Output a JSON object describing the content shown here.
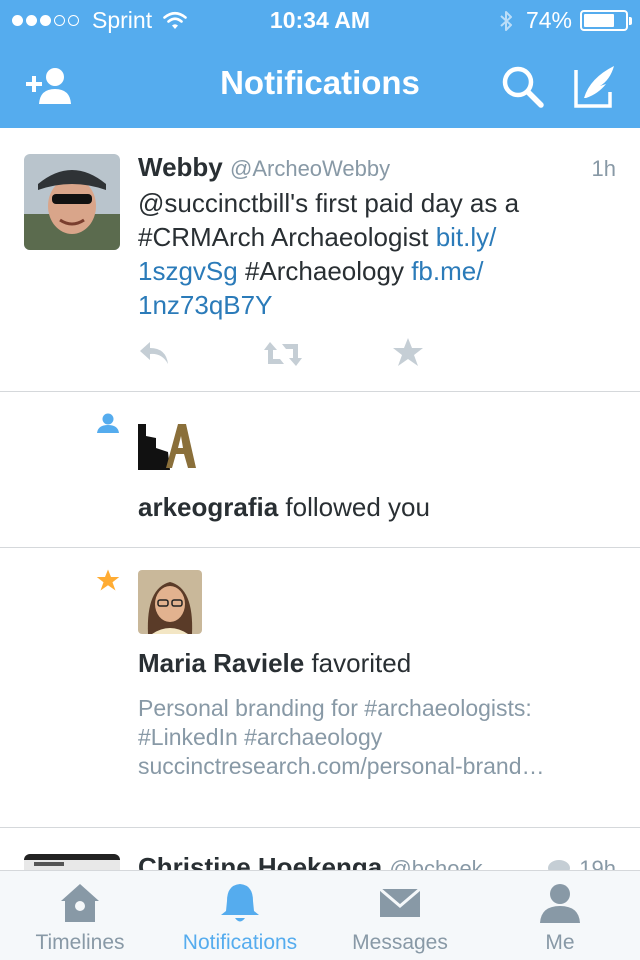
{
  "status_bar": {
    "carrier": "Sprint",
    "time": "10:34 AM",
    "battery": "74%",
    "battery_level": 0.74,
    "signal_bars_filled": 3,
    "signal_bars_total": 5
  },
  "nav": {
    "title": "Notifications",
    "left_icon": "add-user-icon",
    "right_icons": [
      "search-icon",
      "compose-icon"
    ]
  },
  "notifications": [
    {
      "type": "tweet",
      "name": "Webby",
      "handle": "@ArcheoWebby",
      "time": "1h",
      "lines": [
        [
          {
            "t": "@succinctbill's first paid day as a",
            "link": false
          }
        ],
        [
          {
            "t": "#CRMArch Archaeologist ",
            "link": false
          },
          {
            "t": "bit.ly/",
            "link": true
          }
        ],
        [
          {
            "t": "1szgvSg",
            "link": true
          },
          {
            "t": " #Archaeology ",
            "link": false
          },
          {
            "t": "fb.me/",
            "link": true
          }
        ],
        [
          {
            "t": "1nz73qB7Y",
            "link": true
          }
        ]
      ],
      "actions": [
        "reply-icon",
        "retweet-icon",
        "favorite-icon"
      ]
    },
    {
      "type": "follow",
      "icon": "person-icon",
      "name": "arkeografia",
      "action": " followed you"
    },
    {
      "type": "favorite",
      "icon": "star-icon",
      "name": "Maria Raviele",
      "action": " favorited",
      "quoted": [
        "Personal branding for #archaeologists:",
        "#LinkedIn #archaeology",
        "succinctresearch.com/personal-brand…"
      ]
    },
    {
      "type": "tweet-partial",
      "name": "Christine Hoekenga",
      "handle": "@bchoek",
      "time": "19h"
    }
  ],
  "tabs": [
    {
      "label": "Timelines",
      "icon": "home-icon",
      "active": false
    },
    {
      "label": "Notifications",
      "icon": "bell-icon",
      "active": true
    },
    {
      "label": "Messages",
      "icon": "envelope-icon",
      "active": false
    },
    {
      "label": "Me",
      "icon": "profile-icon",
      "active": false
    }
  ],
  "colors": {
    "brand_blue": "#55acee",
    "link_blue": "#2b7bb9",
    "muted_gray": "#8899a6",
    "star_orange": "#ffac33",
    "text_dark": "#292f33",
    "tab_gray": "#8899a6"
  }
}
